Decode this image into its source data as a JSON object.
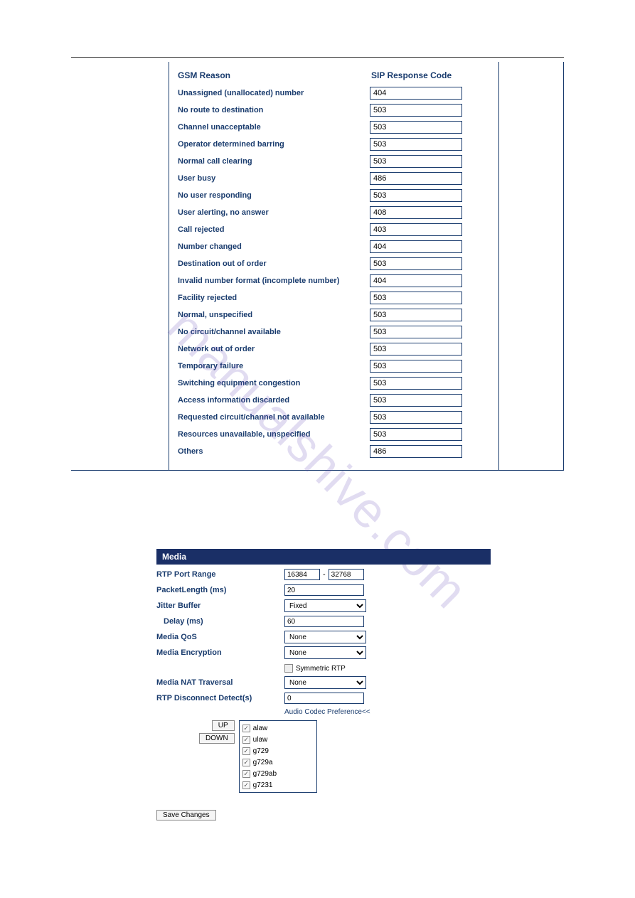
{
  "watermark": "manualshive.com",
  "gsm": {
    "header_label": "GSM Reason",
    "header_sip": "SIP Response Code",
    "rows": [
      {
        "label": "Unassigned (unallocated) number",
        "value": "404"
      },
      {
        "label": "No route to destination",
        "value": "503"
      },
      {
        "label": "Channel unacceptable",
        "value": "503"
      },
      {
        "label": "Operator determined barring",
        "value": "503"
      },
      {
        "label": "Normal call clearing",
        "value": "503"
      },
      {
        "label": "User busy",
        "value": "486"
      },
      {
        "label": "No user responding",
        "value": "503"
      },
      {
        "label": "User alerting, no answer",
        "value": "408"
      },
      {
        "label": "Call rejected",
        "value": "403"
      },
      {
        "label": "Number changed",
        "value": "404"
      },
      {
        "label": "Destination out of order",
        "value": "503"
      },
      {
        "label": "Invalid number format (incomplete number)",
        "value": "404"
      },
      {
        "label": "Facility rejected",
        "value": "503"
      },
      {
        "label": "Normal, unspecified",
        "value": "503"
      },
      {
        "label": "No circuit/channel available",
        "value": "503"
      },
      {
        "label": "Network out of order",
        "value": "503"
      },
      {
        "label": "Temporary failure",
        "value": "503"
      },
      {
        "label": "Switching equipment congestion",
        "value": "503"
      },
      {
        "label": "Access information discarded",
        "value": "503"
      },
      {
        "label": "Requested circuit/channel not available",
        "value": "503"
      },
      {
        "label": "Resources unavailable, unspecified",
        "value": "503"
      },
      {
        "label": "Others",
        "value": "486"
      }
    ]
  },
  "media": {
    "title": "Media",
    "rtp_range_label": "RTP Port Range",
    "rtp_from": "16384",
    "rtp_to": "32768",
    "packet_length_label": "PacketLength (ms)",
    "packet_length_value": "20",
    "jitter_label": "Jitter Buffer",
    "jitter_value": "Fixed",
    "delay_label": "Delay (ms)",
    "delay_value": "60",
    "qos_label": "Media QoS",
    "qos_value": "None",
    "encryption_label": "Media Encryption",
    "encryption_value": "None",
    "symmetric_label": "Symmetric RTP",
    "nat_label": "Media NAT Traversal",
    "nat_value": "None",
    "disconnect_label": "RTP Disconnect Detect(s)",
    "disconnect_value": "0",
    "audio_pref": "Audio Codec Preference<<",
    "up_btn": "UP",
    "down_btn": "DOWN",
    "codecs": [
      "alaw",
      "ulaw",
      "g729",
      "g729a",
      "g729ab",
      "g7231"
    ],
    "save_btn": "Save Changes"
  }
}
